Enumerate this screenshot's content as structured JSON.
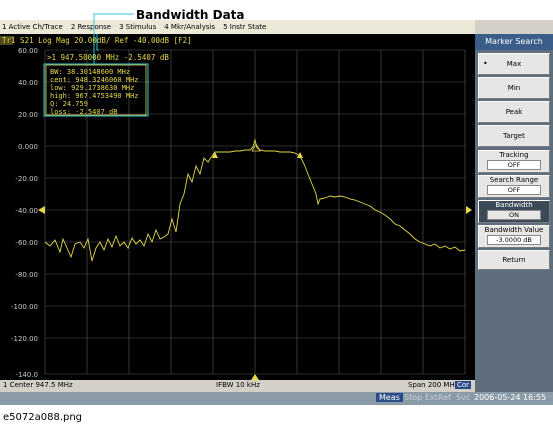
{
  "callout": {
    "title": "Bandwidth Data"
  },
  "menu": [
    "1 Active Ch/Trace",
    "2 Response",
    "3 Stimulus",
    "4 Mkr/Analysis",
    "5 Instr State"
  ],
  "trace_header": "Tr1  S21 Log Mag 20.00dB/ Ref -40.00dB [F2]",
  "marker_readout": ">1   947.50000 MHz -2.5407 dB",
  "bandwidth_box": [
    "BW:  38.30148600 MHz",
    "cent:  948.3246060 MHz",
    "low:  929.1738630 MHz",
    "high:  967.4753490 MHz",
    "Q:  24.759",
    "loss:  -2.5407 dB"
  ],
  "y_ticks": [
    "60.00",
    "40.00",
    "20.00",
    "0.000",
    "-20.00",
    "-40.00",
    "-60.00",
    "-80.00",
    "-100.00",
    "-120.00",
    "-140.0"
  ],
  "status": {
    "center": "1  Center 947.5 MHz",
    "ifbw": "IFBW 10 kHz",
    "span": "Span 200 MHz",
    "cor": "Cor",
    "meas": "Meas",
    "stop": "Stop",
    "extref": "ExtRef",
    "svc": "Svc",
    "datetime": "2006-05-24 16:55"
  },
  "softkeys": {
    "header": "Marker Search",
    "max": "Max",
    "min": "Min",
    "peak": "Peak",
    "target": "Target",
    "tracking": "Tracking",
    "tracking_value": "OFF",
    "search_range": "Search Range",
    "search_range_value": "OFF",
    "bandwidth": "Bandwidth",
    "bandwidth_value": "ON",
    "bandwidth_value_label": "Bandwidth Value",
    "bandwidth_value_value": "-3.0000 dB",
    "return": "Return"
  },
  "caption": "e5072a088.png",
  "colors": {
    "trace": "#e6d84a",
    "grid": "#5a5a5a",
    "axis_text": "#c8c8c8",
    "marker_text": "#e6d84a",
    "callout": "#33c8d8"
  }
}
